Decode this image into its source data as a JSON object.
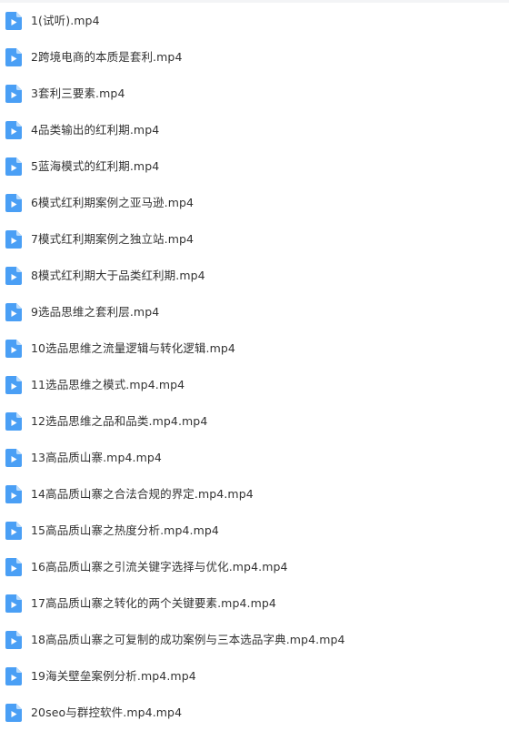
{
  "files": [
    {
      "name": "1(试听).mp4",
      "icon": "video-file-icon"
    },
    {
      "name": "2跨境电商的本质是套利.mp4",
      "icon": "video-file-icon"
    },
    {
      "name": "3套利三要素.mp4",
      "icon": "video-file-icon"
    },
    {
      "name": "4品类输出的红利期.mp4",
      "icon": "video-file-icon"
    },
    {
      "name": "5蓝海模式的红利期.mp4",
      "icon": "video-file-icon"
    },
    {
      "name": "6模式红利期案例之亚马逊.mp4",
      "icon": "video-file-icon"
    },
    {
      "name": "7模式红利期案例之独立站.mp4",
      "icon": "video-file-icon"
    },
    {
      "name": "8模式红利期大于品类红利期.mp4",
      "icon": "video-file-icon"
    },
    {
      "name": "9选品思维之套利层.mp4",
      "icon": "video-file-icon"
    },
    {
      "name": "10选品思维之流量逻辑与转化逻辑.mp4",
      "icon": "video-file-icon"
    },
    {
      "name": "11选品思维之模式.mp4.mp4",
      "icon": "video-file-icon"
    },
    {
      "name": "12选品思维之品和品类.mp4.mp4",
      "icon": "video-file-icon"
    },
    {
      "name": "13高品质山寨.mp4.mp4",
      "icon": "video-file-icon"
    },
    {
      "name": "14高品质山寨之合法合规的界定.mp4.mp4",
      "icon": "video-file-icon"
    },
    {
      "name": "15高品质山寨之热度分析.mp4.mp4",
      "icon": "video-file-icon"
    },
    {
      "name": "16高品质山寨之引流关键字选择与优化.mp4.mp4",
      "icon": "video-file-icon"
    },
    {
      "name": "17高品质山寨之转化的两个关键要素.mp4.mp4",
      "icon": "video-file-icon"
    },
    {
      "name": "18高品质山寨之可复制的成功案例与三本选品字典.mp4.mp4",
      "icon": "video-file-icon"
    },
    {
      "name": "19海关壁垒案例分析.mp4.mp4",
      "icon": "video-file-icon"
    },
    {
      "name": "20seo与群控软件.mp4.mp4",
      "icon": "video-file-icon"
    }
  ],
  "colors": {
    "icon_blue": "#4a9ff5",
    "icon_fold": "#b9dbfc",
    "text": "#333333"
  }
}
